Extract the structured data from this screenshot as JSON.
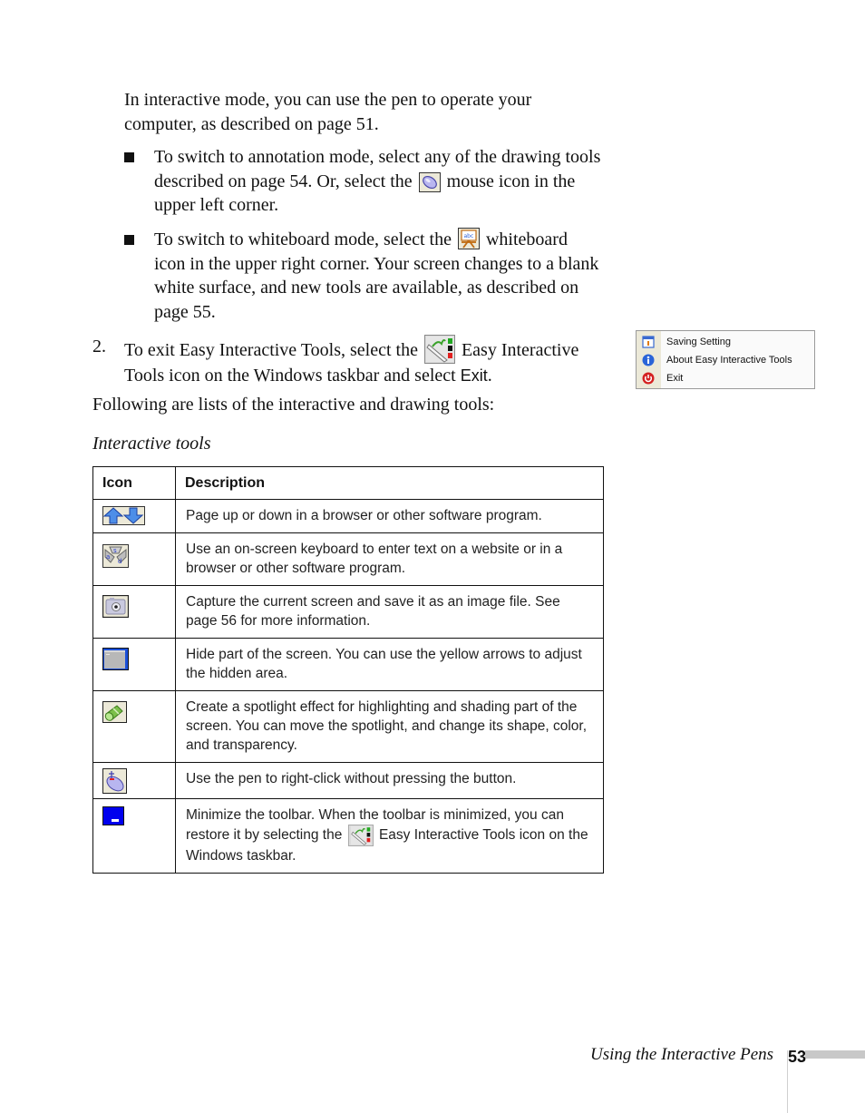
{
  "intro": {
    "line1": "In interactive mode, you can use the pen to operate your",
    "line2": "computer, as described on page 51."
  },
  "bullets": [
    {
      "part1": "To switch to annotation mode, select any of the drawing tools",
      "part2a": "described on page 54. Or, select the",
      "icon": "mouse-icon",
      "part2b": "mouse icon in the",
      "part3": "upper left corner."
    },
    {
      "part1a": "To switch to whiteboard mode, select the",
      "icon": "whiteboard-icon",
      "part1b": "whiteboard",
      "part2": "icon in the upper right corner. Your screen changes to a blank",
      "part3": "white surface, and new tools are available, as described on",
      "part4": "page 55."
    }
  ],
  "step2": {
    "number": "2.",
    "part1a": "To exit Easy Interactive Tools, select the",
    "icon": "easy-interactive-tools-icon",
    "part1b": "Easy Interactive",
    "part2a": "Tools icon on the Windows taskbar and select",
    "exit_label": "Exit",
    "part2b": "."
  },
  "following": "Following are lists of the interactive and drawing tools:",
  "section_heading": "Interactive tools",
  "context_menu": {
    "items": [
      {
        "icon": "saving-setting-icon",
        "label": "Saving Setting"
      },
      {
        "icon": "info-icon",
        "label": "About Easy Interactive Tools"
      },
      {
        "icon": "power-icon",
        "label": "Exit"
      }
    ]
  },
  "table": {
    "headers": [
      "Icon",
      "Description"
    ],
    "rows": [
      {
        "icon": "page-up-down-icon",
        "description": "Page up or down in a browser or other software program."
      },
      {
        "icon": "on-screen-keyboard-icon",
        "description": "Use an on-screen keyboard to enter text on a website or in a browser or other software program."
      },
      {
        "icon": "camera-icon",
        "description": "Capture the current screen and save it as an image file. See page 56 for more information."
      },
      {
        "icon": "screen-shade-icon",
        "description": "Hide part of the screen. You can use the yellow arrows to adjust the hidden area."
      },
      {
        "icon": "spotlight-icon",
        "description": "Create a spotlight effect for highlighting and shading part of the screen. You can move the spotlight, and change its shape, color, and transparency."
      },
      {
        "icon": "right-click-icon",
        "description": "Use the pen to right-click without pressing the button."
      },
      {
        "icon": "minimize-icon",
        "description_a": "Minimize the toolbar. When the toolbar is minimized, you can restore it by selecting the",
        "inline_icon": "easy-interactive-tools-icon",
        "description_b": "Easy Interactive Tools icon on the Windows taskbar."
      }
    ]
  },
  "footer": {
    "title": "Using the Interactive Pens",
    "page_number": "53"
  },
  "colors": {
    "text": "#111111",
    "table_border": "#111111",
    "footer_bar": "#c8c8c8",
    "icon_blue": "#2a5fd8",
    "minimize_blue": "#0000ee"
  }
}
